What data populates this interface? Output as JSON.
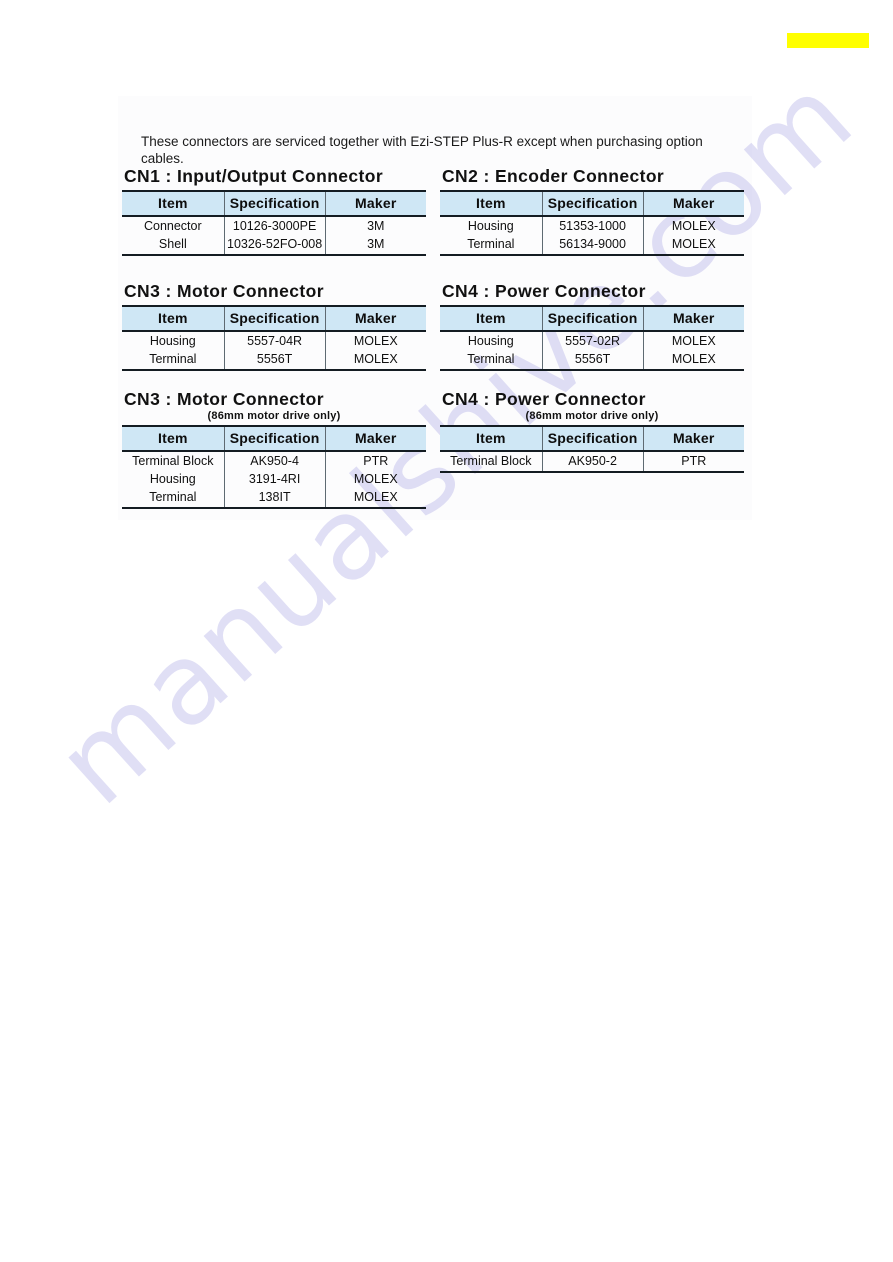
{
  "page": {
    "intro_note": "These connectors are serviced together with Ezi-STEP Plus-R except when purchasing option cables.",
    "watermark_text": "manualshive.com",
    "highlight_color": "#ffff00",
    "header_fill_color": "#cfe7f5",
    "rule_color": "#141c22"
  },
  "table_headers": {
    "item": "Item",
    "specification": "Specification",
    "maker": "Maker"
  },
  "panels": [
    {
      "id": "cn1",
      "title": "CN1 : Input/Output Connector",
      "subtitle": "",
      "rows": [
        {
          "item": "Connector",
          "specification": "10126-3000PE",
          "maker": "3M"
        },
        {
          "item": "Shell",
          "specification": "10326-52FO-008",
          "maker": "3M"
        }
      ]
    },
    {
      "id": "cn2",
      "title": "CN2 : Encoder Connector",
      "subtitle": "",
      "rows": [
        {
          "item": "Housing",
          "specification": "51353-1000",
          "maker": "MOLEX"
        },
        {
          "item": "Terminal",
          "specification": "56134-9000",
          "maker": "MOLEX"
        }
      ]
    },
    {
      "id": "cn3",
      "title": "CN3 : Motor Connector",
      "subtitle": "",
      "rows": [
        {
          "item": "Housing",
          "specification": "5557-04R",
          "maker": "MOLEX"
        },
        {
          "item": "Terminal",
          "specification": "5556T",
          "maker": "MOLEX"
        }
      ]
    },
    {
      "id": "cn4",
      "title": "CN4 : Power Connector",
      "subtitle": "",
      "rows": [
        {
          "item": "Housing",
          "specification": "5557-02R",
          "maker": "MOLEX"
        },
        {
          "item": "Terminal",
          "specification": "5556T",
          "maker": "MOLEX"
        }
      ]
    },
    {
      "id": "cn3-86mm",
      "title": "CN3 : Motor Connector",
      "subtitle": "(86mm motor drive only)",
      "rows": [
        {
          "item": "Terminal Block",
          "specification": "AK950-4",
          "maker": "PTR"
        },
        {
          "item": "Housing",
          "specification": "3191-4RI",
          "maker": "MOLEX"
        },
        {
          "item": "Terminal",
          "specification": "138IT",
          "maker": "MOLEX"
        }
      ]
    },
    {
      "id": "cn4-86mm",
      "title": "CN4 : Power Connector",
      "subtitle": "(86mm motor drive only)",
      "rows": [
        {
          "item": "Terminal Block",
          "specification": "AK950-2",
          "maker": "PTR"
        }
      ]
    }
  ]
}
